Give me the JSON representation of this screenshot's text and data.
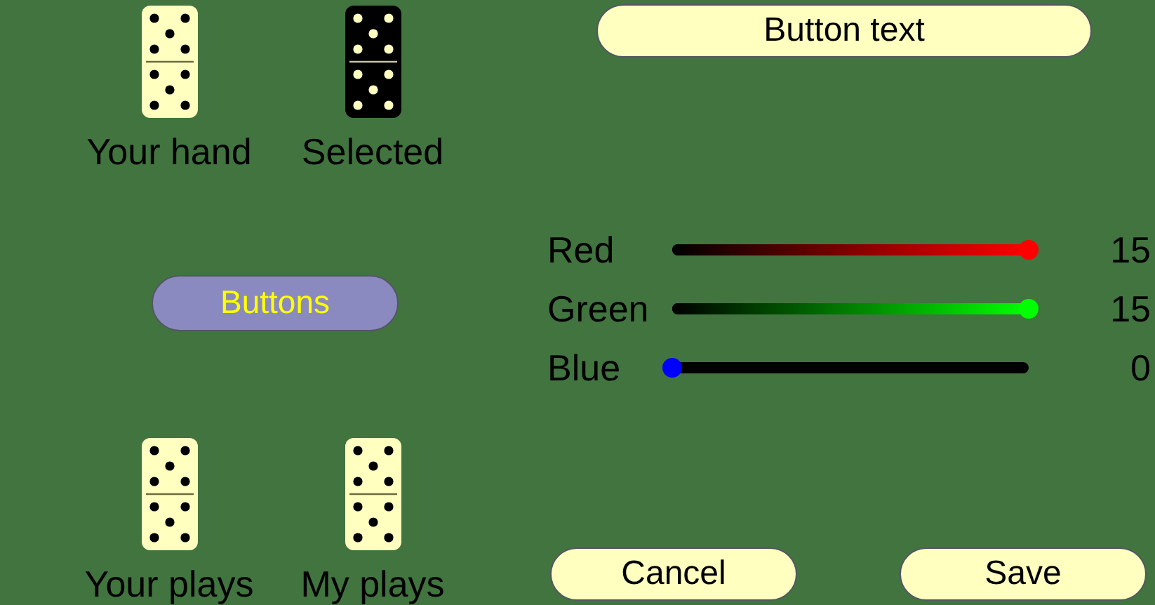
{
  "dominoes": [
    {
      "label": "Your hand",
      "kind": "light"
    },
    {
      "label": "Selected",
      "kind": "dark"
    },
    {
      "label": "Your plays",
      "kind": "light"
    },
    {
      "label": "My plays",
      "kind": "light"
    }
  ],
  "buttons_button": "Buttons",
  "preview_button": "Button text",
  "sliders": [
    {
      "label": "Red",
      "color": "#ff0000",
      "level": 1,
      "reading": "15"
    },
    {
      "label": "Green",
      "color": "#00ff00",
      "level": 1,
      "reading": "15"
    },
    {
      "label": "Blue",
      "color": "#0000ff",
      "level": 0,
      "reading": "0"
    }
  ],
  "actions": [
    "Cancel",
    "Save"
  ]
}
